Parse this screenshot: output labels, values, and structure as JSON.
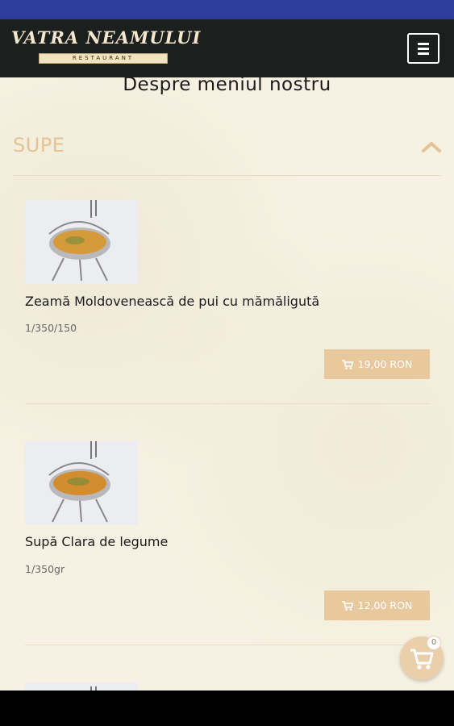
{
  "header": {
    "logo_title": "VATRA NEAMULUI",
    "logo_subtitle": "RESTAURANT",
    "menu_icon": "hamburger-icon"
  },
  "page": {
    "title": "Despre meniul nostru"
  },
  "category": {
    "title": "SUPE",
    "toggle_icon": "chevron-up-icon"
  },
  "items": [
    {
      "name": "Zeamă Moldovenească de pui cu mămăligută",
      "portion": "1/350/150",
      "price": "19,00 RON",
      "image_icon": "soup-bowl-image"
    },
    {
      "name": "Supă Clara de legume",
      "portion": "1/350gr",
      "price": "12,00 RON",
      "image_icon": "soup-bowl-image"
    }
  ],
  "cart": {
    "count": "0",
    "icon": "shopping-cart-icon"
  },
  "colors": {
    "header_bg": "#1b1f1e",
    "status_bar": "#2d3e9e",
    "accent": "#e8c99d",
    "background": "#f6f1e2"
  }
}
